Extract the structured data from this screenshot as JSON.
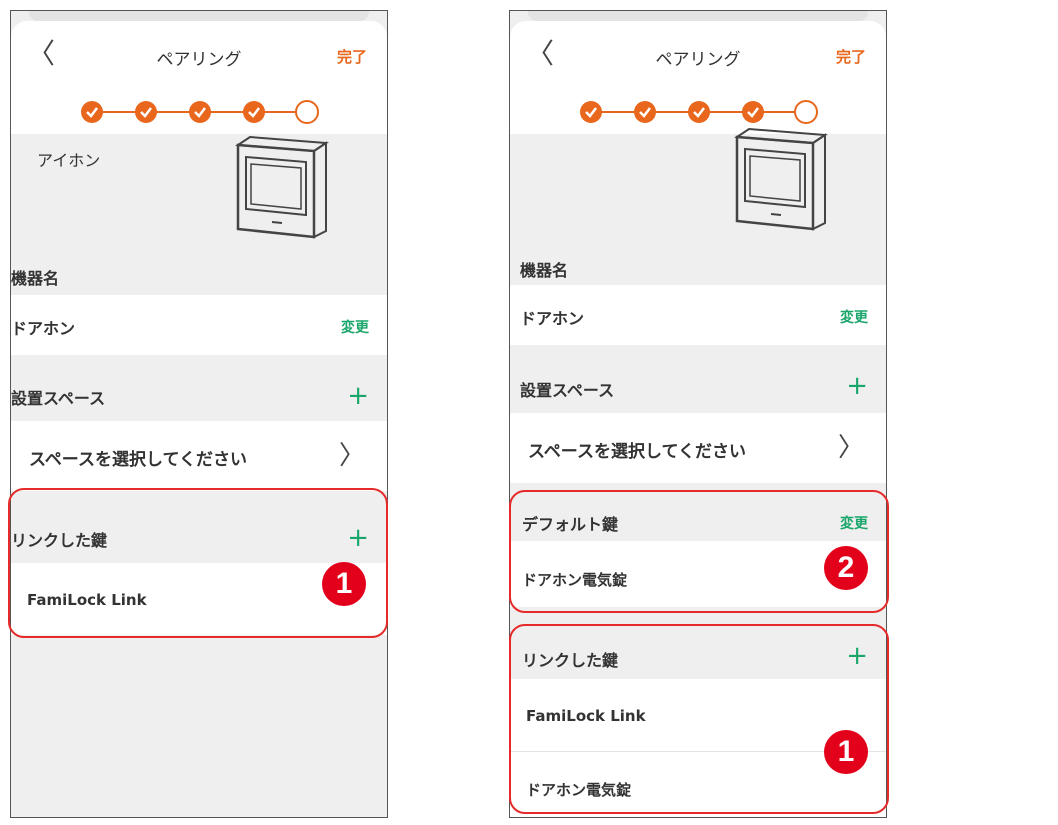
{
  "common": {
    "title": "ペアリング",
    "done_label": "完了",
    "device_name_section": "機器名",
    "device_name_value": "ドアホン",
    "change_label": "変更",
    "space_section": "設置スペース",
    "space_prompt": "スペースを選択してください",
    "linked_keys_section": "リンクした鍵"
  },
  "steps": {
    "completed": 4,
    "total": 5
  },
  "colors": {
    "accent": "#e8671c",
    "green": "#1aa66a",
    "highlight": "#e62a2a",
    "badge": "#e3001b"
  },
  "screen1": {
    "device_type_label": "アイホン",
    "linked_keys": [
      "FamiLock Link"
    ],
    "badge": "1"
  },
  "screen2": {
    "default_key_section": "デフォルト鍵",
    "default_key_value": "ドアホン電気錠",
    "linked_keys": [
      "FamiLock Link",
      "ドアホン電気錠"
    ],
    "badge_default": "2",
    "badge_linked": "1"
  }
}
